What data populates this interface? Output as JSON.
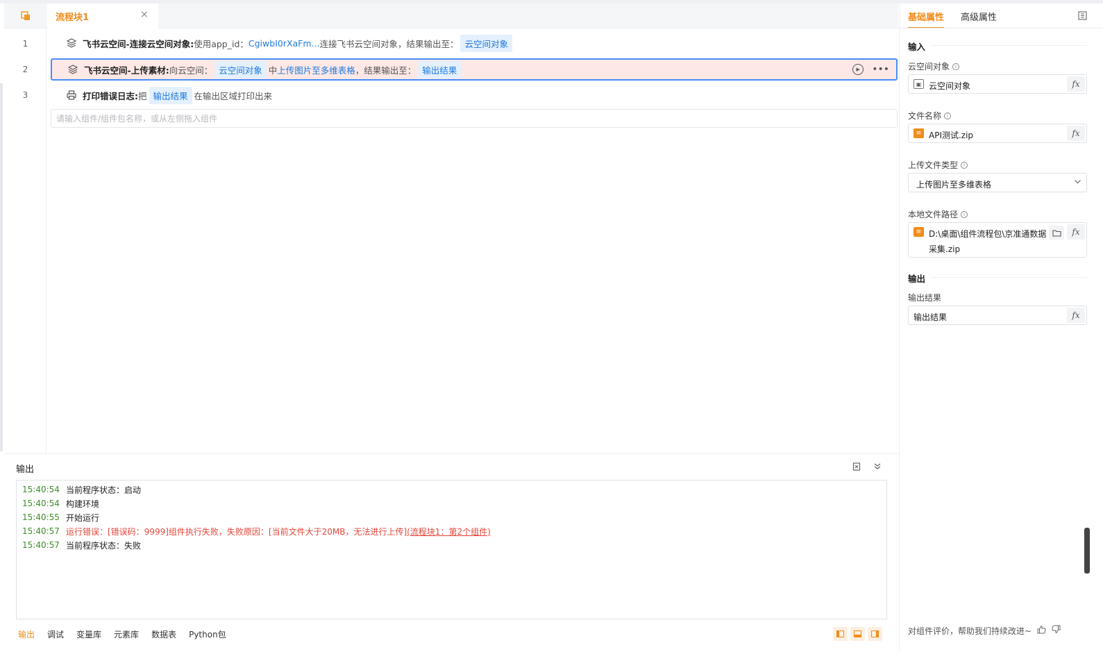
{
  "tab": {
    "title": "流程块1",
    "close_icon": "×"
  },
  "steps": [
    {
      "num": "1",
      "icon": "layers-icon",
      "name": "飞书云空间-连接云空间对象:",
      "text1": "使用app_id：",
      "link1": "CgiwbI0rXaFm...",
      "text2": "连接飞书云空间对象，结果输出至：",
      "chip1": "云空间对象"
    },
    {
      "num": "2",
      "icon": "layers-icon",
      "name": "飞书云空间-上传素材:",
      "text1": "向云空间：",
      "chip1": "云空间对象",
      "text2": "中",
      "link1": "上传图片至多维表格",
      "text3": "，结果输出至：",
      "chip2": "输出结果"
    },
    {
      "num": "3",
      "icon": "printer-icon",
      "name": "打印错误日志:",
      "text1": "把",
      "chip1": "输出结果",
      "text2": "在输出区域打印出来"
    }
  ],
  "component_search": {
    "placeholder": "请输入组件/组件包名称，或从左侧拖入组件"
  },
  "output": {
    "title": "输出",
    "logs": [
      {
        "time": "15:40:54",
        "msg": "当前程序状态：启动",
        "error": false
      },
      {
        "time": "15:40:54",
        "msg": "构建环境",
        "error": false
      },
      {
        "time": "15:40:55",
        "msg": "开始运行",
        "error": false
      },
      {
        "time": "15:40:57",
        "msg": "运行错误：[错误码：9999]组件执行失败，失败原因：[当前文件大于20MB，无法进行上传]",
        "link": "(流程块1：第2个组件)",
        "error": true
      },
      {
        "time": "15:40:57",
        "msg": "当前程序状态：失败",
        "error": false
      }
    ]
  },
  "bottom_tabs": [
    "输出",
    "调试",
    "变量库",
    "元素库",
    "数据表",
    "Python包"
  ],
  "props": {
    "tabs": [
      "基础属性",
      "高级属性"
    ],
    "input_section": "输入",
    "output_section": "输出",
    "fields": {
      "cloud_obj": {
        "label": "云空间对象",
        "value": "云空间对象"
      },
      "file_name": {
        "label": "文件名称",
        "value": "API测试.zip"
      },
      "upload_type": {
        "label": "上传文件类型",
        "value": "上传图片至多维表格"
      },
      "local_path": {
        "label": "本地文件路径",
        "value_line1": "D:\\桌面\\组件流程包\\京准通数据",
        "value_line2": "采集.zip"
      },
      "out_result": {
        "label": "输出结果",
        "value": "输出结果"
      }
    },
    "fx": "fx",
    "feedback": "对组件评价，帮助我们持续改进~"
  },
  "colors": {
    "accent": "#f08c1a",
    "link": "#1f7ae0",
    "selected_row_bg": "#fde8e6",
    "selected_row_border": "#4a8df6",
    "log_time": "#3d8c2b",
    "log_error": "#e5463a"
  }
}
